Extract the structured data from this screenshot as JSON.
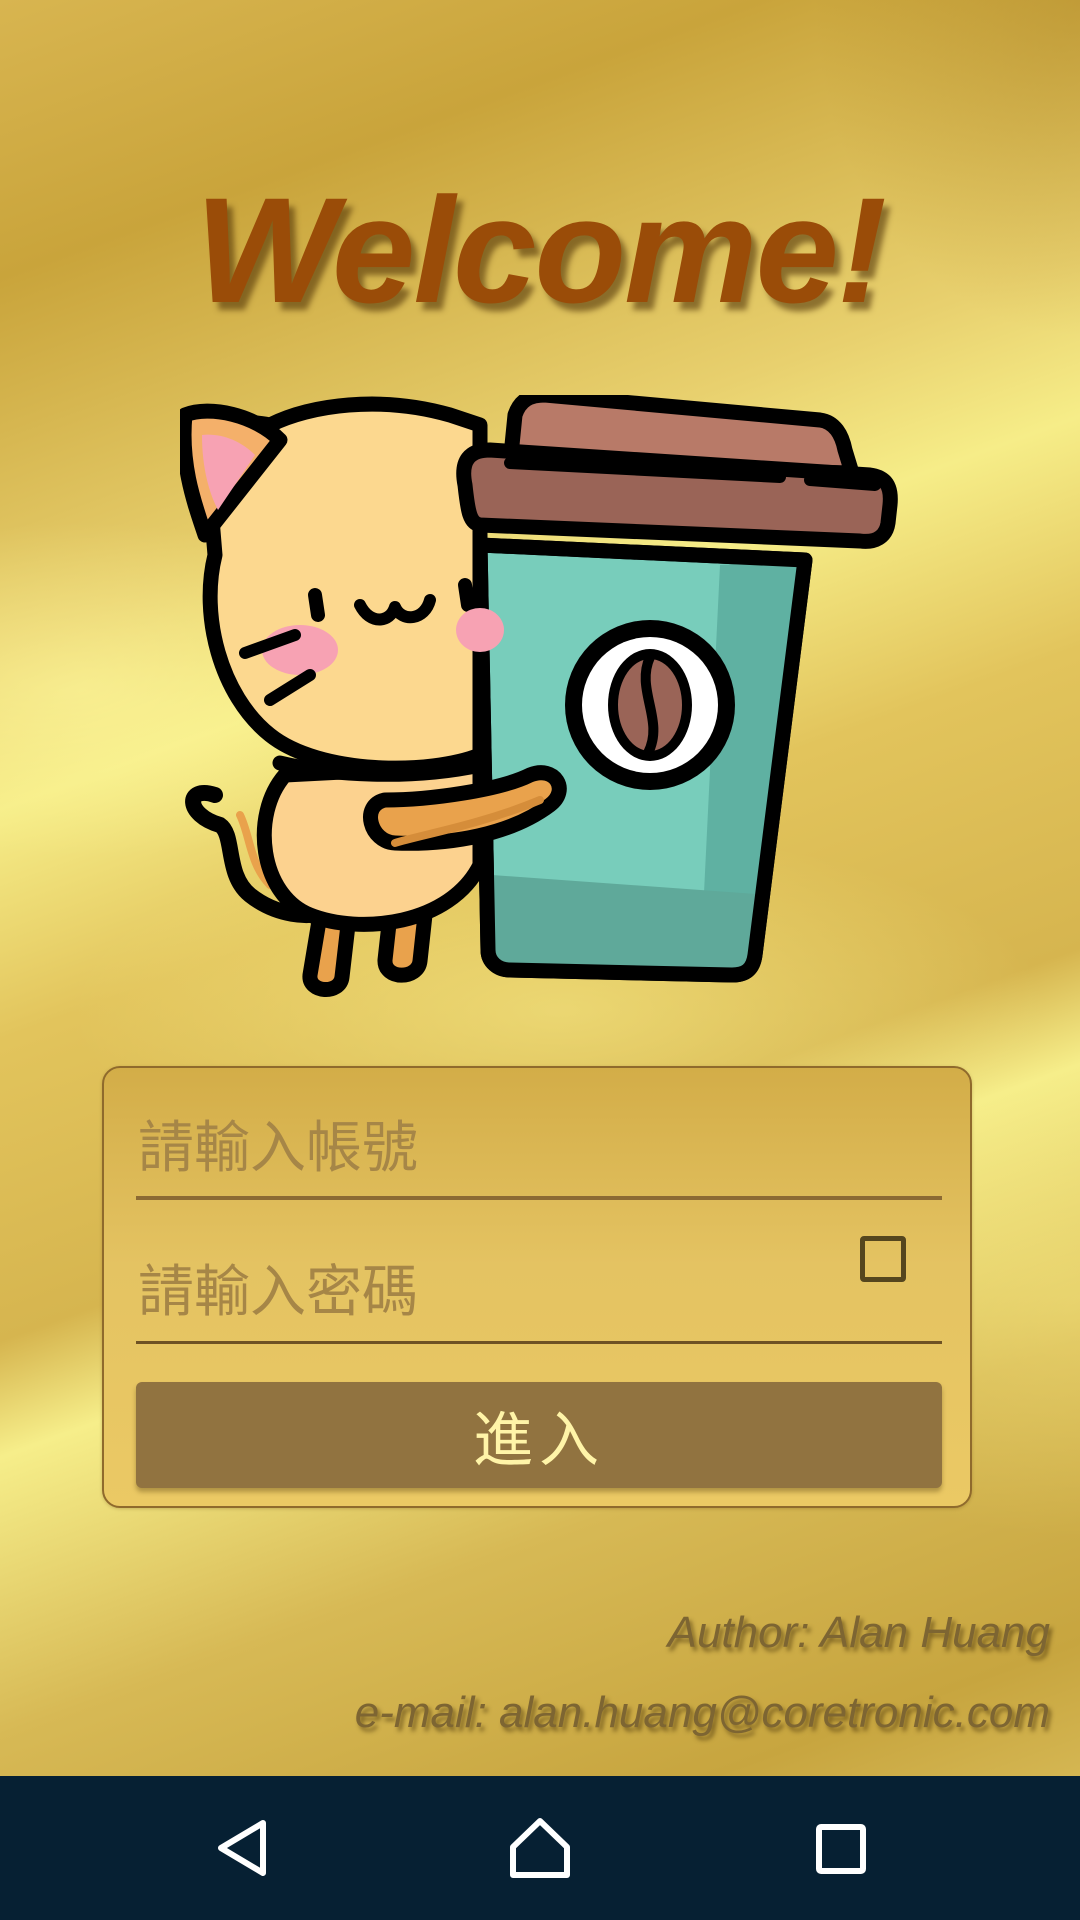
{
  "header": {
    "title": "Welcome!"
  },
  "illustration": {
    "icon": "cat-holding-coffee-cup-icon"
  },
  "login": {
    "account_placeholder": "請輸入帳號",
    "account_value": "",
    "password_placeholder": "請輸入密碼",
    "password_value": "",
    "show_password_checked": false,
    "submit_label": "進入"
  },
  "footer": {
    "author": "Author: Alan Huang",
    "email": "e-mail: alan.huang@coretronic.com"
  },
  "system_nav": {
    "back_icon": "back-triangle-icon",
    "home_icon": "home-icon",
    "recent_icon": "recent-apps-icon"
  },
  "colors": {
    "title": "#9a4c08",
    "button_bg": "#917340",
    "button_text": "#fff4a8",
    "navbar_bg": "#062033"
  }
}
